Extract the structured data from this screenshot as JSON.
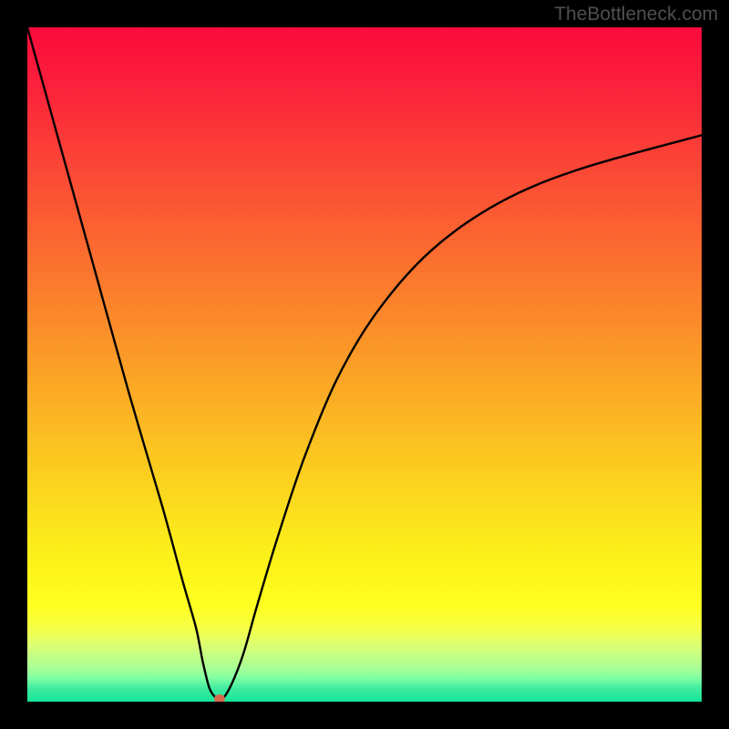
{
  "watermark": "TheBottleneck.com",
  "chart_data": {
    "type": "line",
    "title": "",
    "xlabel": "",
    "ylabel": "",
    "xlim": [
      0,
      100
    ],
    "ylim": [
      0,
      100
    ],
    "grid": false,
    "legend": false,
    "series": [
      {
        "name": "bottleneck-curve",
        "x": [
          0,
          5,
          10,
          15,
          20,
          23,
          25,
          26,
          27,
          28,
          28.5,
          30,
          32,
          34,
          37,
          41,
          46,
          52,
          60,
          70,
          82,
          100
        ],
        "values": [
          100,
          82,
          64,
          46,
          29,
          18,
          11,
          6,
          2,
          0.5,
          0,
          2,
          7,
          14,
          24,
          36,
          48,
          58,
          67,
          74,
          79,
          84
        ]
      },
      {
        "name": "min-marker",
        "type": "scatter",
        "x": [
          28.5
        ],
        "values": [
          0
        ]
      }
    ],
    "gradient_stops": [
      {
        "pos": 0,
        "color": "#fb0a3d"
      },
      {
        "pos": 18,
        "color": "#fb3e37"
      },
      {
        "pos": 38,
        "color": "#fb7a2d"
      },
      {
        "pos": 58,
        "color": "#fbb623"
      },
      {
        "pos": 77,
        "color": "#fced1b"
      },
      {
        "pos": 86,
        "color": "#feff22"
      },
      {
        "pos": 93,
        "color": "#c7ff83"
      },
      {
        "pos": 100,
        "color": "#14e499"
      }
    ]
  }
}
